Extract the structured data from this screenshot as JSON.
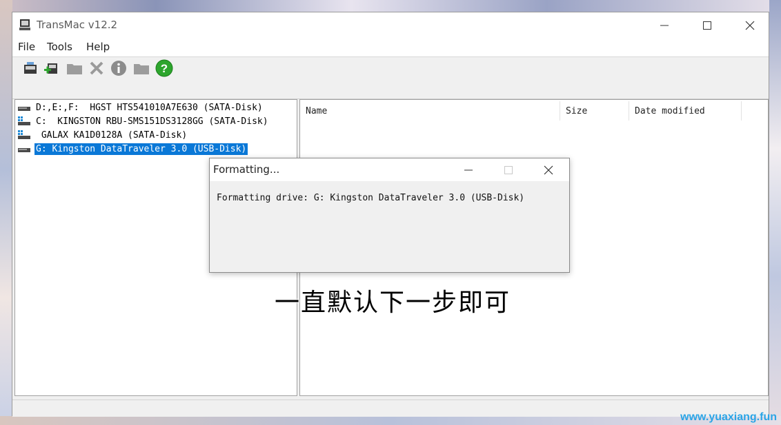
{
  "window": {
    "title": "TransMac v12.2"
  },
  "menu": {
    "items": [
      "File",
      "Tools",
      "Help"
    ]
  },
  "toolbar": {
    "icons": [
      "open-disk-image-icon",
      "add-disk-image-icon",
      "new-folder-icon",
      "delete-icon",
      "info-icon",
      "folder-icon",
      "help-icon"
    ]
  },
  "drives": [
    {
      "label": "D:,E:,F:  HGST HTS541010A7E630 (SATA-Disk)",
      "selected": false
    },
    {
      "label": "C:  KINGSTON RBU-SMS151DS3128GG (SATA-Disk)",
      "selected": false
    },
    {
      "label": " GALAX KA1D0128A (SATA-Disk)",
      "selected": false
    },
    {
      "label": "G: Kingston DataTraveler 3.0 (USB-Disk)",
      "selected": true
    }
  ],
  "file_list": {
    "columns": [
      "Name",
      "Size",
      "Date modified"
    ]
  },
  "dialog": {
    "title": "Formatting...",
    "message": "Formatting drive: G: Kingston DataTraveler 3.0 (USB-Disk)"
  },
  "caption": "一直默认下一步即可",
  "watermark": "www.yuaxiang.fun",
  "colors": {
    "selection": "#0a78d7",
    "help_icon": "#2da52d",
    "info_icon": "#808080"
  }
}
